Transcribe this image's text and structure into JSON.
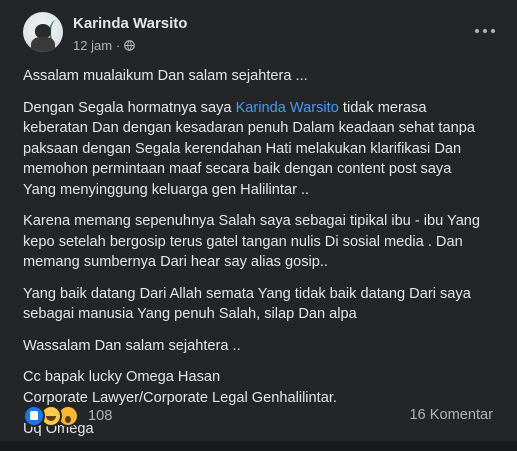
{
  "post": {
    "author": "Karinda Warsito",
    "time": "12 jam",
    "time_separator": "·",
    "paragraphs": [
      {
        "lines": [
          "Assalam mualaikum  Dan salam sejahtera ..."
        ]
      },
      {
        "lines_with_mention": true,
        "line1_before": "Dengan Segala hormatnya saya ",
        "mention": "Karinda Warsito",
        "line1_after": "  tidak merasa",
        "lines": [
          "keberatan Dan dengan kesadaran penuh Dalam keadaan sehat  tanpa",
          "paksaan dengan Segala kerendahan Hati melakukan  klarifikasi Dan",
          "memohon permintaan maaf secara baik dengan content post saya",
          "Yang menyinggung keluarga gen Halilintar  .."
        ]
      },
      {
        "lines": [
          "Karena memang sepenuhnya Salah saya sebagai tipikal ibu - ibu Yang",
          "kepo setelah bergosip terus gatel tangan nulis Di sosial media .  Dan",
          "memang sumbernya Dari hear say alias gosip.."
        ]
      },
      {
        "lines": [
          "Yang baik datang Dari Allah semata Yang tidak baik datang Dari saya",
          "sebagai manusia Yang penuh Salah, silap Dan alpa"
        ]
      },
      {
        "lines": [
          "Wassalam  Dan salam sejahtera .."
        ]
      },
      {
        "lines": [
          "Cc bapak lucky Omega Hasan",
          "Corporate Lawyer/Corporate Legal Genhalilintar."
        ]
      },
      {
        "lines": [
          "Uq Omega"
        ]
      }
    ],
    "reaction_count": "108",
    "comment_count": "16 Komentar"
  },
  "icons": {
    "more": "more-horizontal-icon",
    "privacy": "globe-icon",
    "reactions": [
      "like-icon",
      "haha-icon",
      "wow-icon"
    ]
  },
  "colors": {
    "background": "#242526",
    "text": "#e4e6eb",
    "secondary_text": "#b0b3b8",
    "mention": "#4599ff",
    "like": "#1877f2"
  }
}
